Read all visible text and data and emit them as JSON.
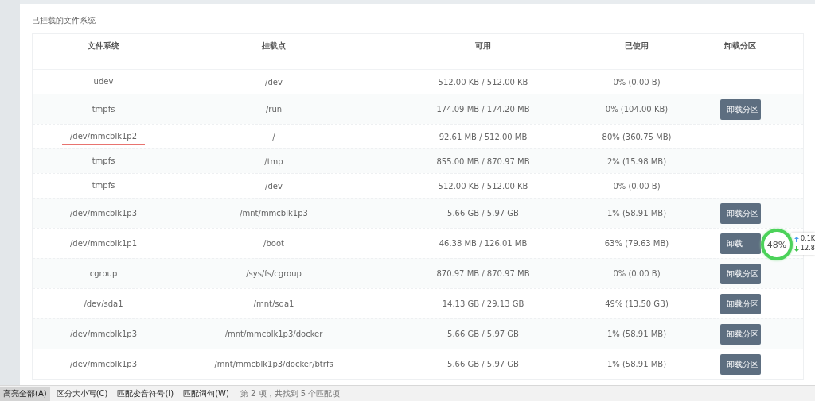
{
  "section_title": "已挂载的文件系统",
  "table": {
    "columns": [
      "文件系统",
      "挂载点",
      "可用",
      "已使用",
      "卸载分区"
    ],
    "rows": [
      {
        "filesystem": "udev",
        "mount_point": "/dev",
        "available": "512.00 KB / 512.00 KB",
        "used": "0% (0.00 B)",
        "underlined": false
      },
      {
        "filesystem": "tmpfs",
        "mount_point": "/run",
        "available": "174.09 MB / 174.20 MB",
        "used": "0% (104.00 KB)",
        "unmount_button": "卸载分区",
        "underlined": false
      },
      {
        "filesystem": "/dev/mmcblk1p2",
        "mount_point": "/",
        "available": "92.61 MB / 512.00 MB",
        "used": "80% (360.75 MB)",
        "underlined": true
      },
      {
        "filesystem": "tmpfs",
        "mount_point": "/tmp",
        "available": "855.00 MB / 870.97 MB",
        "used": "2% (15.98 MB)",
        "underlined": false
      },
      {
        "filesystem": "tmpfs",
        "mount_point": "/dev",
        "available": "512.00 KB / 512.00 KB",
        "used": "0% (0.00 B)",
        "underlined": false
      },
      {
        "filesystem": "/dev/mmcblk1p3",
        "mount_point": "/mnt/mmcblk1p3",
        "available": "5.66 GB / 5.97 GB",
        "used": "1% (58.91 MB)",
        "unmount_button": "卸载分区",
        "underlined": false
      },
      {
        "filesystem": "/dev/mmcblk1p1",
        "mount_point": "/boot",
        "available": "46.38 MB / 126.01 MB",
        "used": "63% (79.63 MB)",
        "unmount_button": "卸载",
        "underlined": false
      },
      {
        "filesystem": "cgroup",
        "mount_point": "/sys/fs/cgroup",
        "available": "870.97 MB / 870.97 MB",
        "used": "0% (0.00 B)",
        "unmount_button": "卸载分区",
        "underlined": false
      },
      {
        "filesystem": "/dev/sda1",
        "mount_point": "/mnt/sda1",
        "available": "14.13 GB / 29.13 GB",
        "used": "49% (13.50 GB)",
        "unmount_button": "卸载分区",
        "underlined": false
      },
      {
        "filesystem": "/dev/mmcblk1p3",
        "mount_point": "/mnt/mmcblk1p3/docker",
        "available": "5.66 GB / 5.97 GB",
        "used": "1% (58.91 MB)",
        "unmount_button": "卸载分区",
        "underlined": false
      },
      {
        "filesystem": "/dev/mmcblk1p3",
        "mount_point": "/mnt/mmcblk1p3/docker/btrfs",
        "available": "5.66 GB / 5.97 GB",
        "used": "1% (58.91 MB)",
        "unmount_button": "卸载分区",
        "underlined": false
      }
    ]
  },
  "speed_widget": {
    "percent": "48%",
    "upload": "0.1K",
    "download": "12.8"
  },
  "find_bar": {
    "options": [
      {
        "label": "高亮全部(A)",
        "selected": true
      },
      {
        "label": "区分大小写(C)",
        "selected": false
      },
      {
        "label": "匹配变音符号(I)",
        "selected": false
      },
      {
        "label": "匹配词句(W)",
        "selected": false
      }
    ],
    "status": "第 2 项，共找到 5 个匹配项"
  }
}
